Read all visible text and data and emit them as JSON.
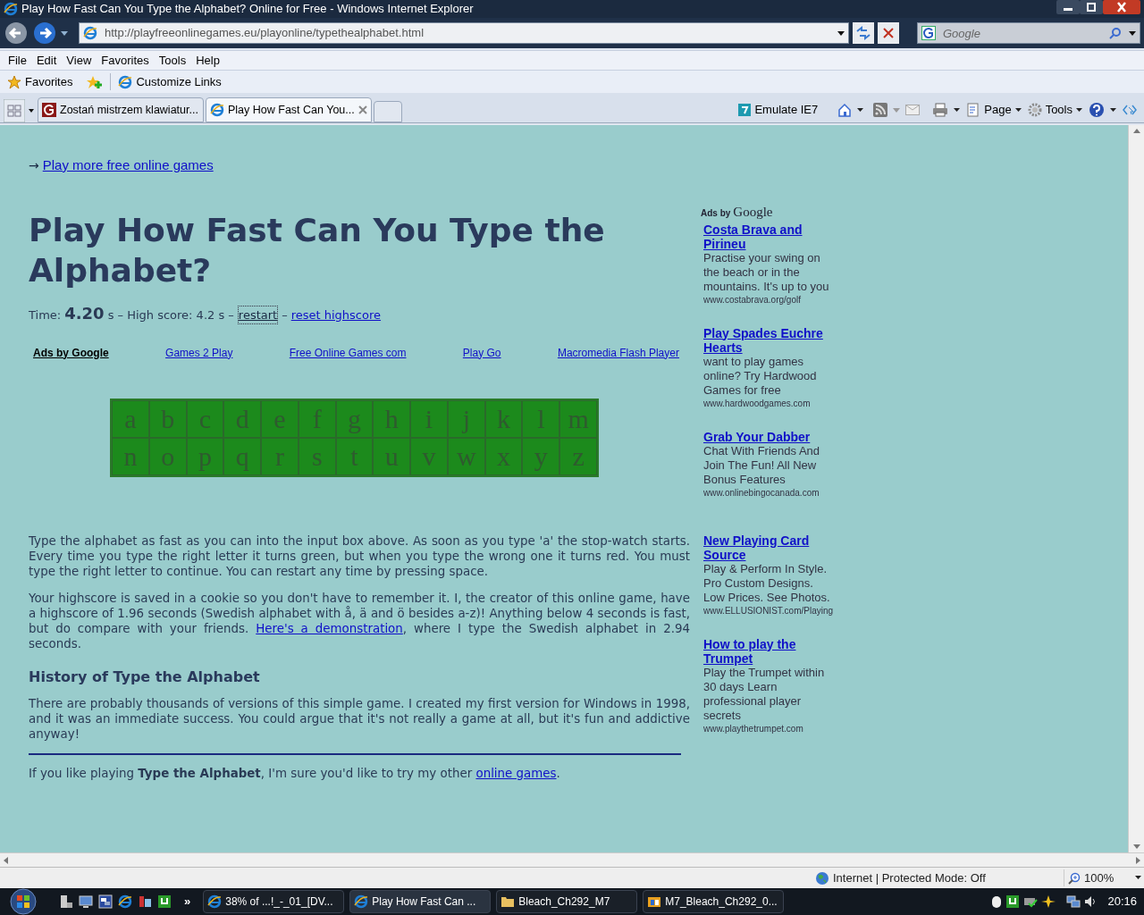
{
  "window": {
    "title": "Play How Fast Can You Type the Alphabet? Online for Free - Windows Internet Explorer"
  },
  "address": "http://playfreeonlinegames.eu/playonline/typethealphabet.html",
  "search": {
    "placeholder": "Google"
  },
  "menu": [
    "File",
    "Edit",
    "View",
    "Favorites",
    "Tools",
    "Help"
  ],
  "favorites_bar": {
    "favorites": "Favorites",
    "link": "Customize Links"
  },
  "tabs": [
    {
      "label": "Zostań mistrzem klawiatur...",
      "selected": false
    },
    {
      "label": "Play How Fast Can You...",
      "selected": true
    }
  ],
  "command_bar": {
    "emulate": "Emulate IE7",
    "page": "Page",
    "tools": "Tools"
  },
  "page": {
    "top_arrow": "→",
    "top_link": "Play more free online games",
    "heading": "Play How Fast Can You Type the Alphabet?",
    "timer": {
      "label": "Time:",
      "value": "4.20",
      "rest": "s – High score: 4.2 s –",
      "restart": "restart",
      "dash": "–",
      "reset": "reset highscore"
    },
    "ad_links": [
      "Ads by Google",
      "Games 2 Play",
      "Free Online Games com",
      "Play Go",
      "Macromedia Flash Player"
    ],
    "letters": [
      "a",
      "b",
      "c",
      "d",
      "e",
      "f",
      "g",
      "h",
      "i",
      "j",
      "k",
      "l",
      "m",
      "n",
      "o",
      "p",
      "q",
      "r",
      "s",
      "t",
      "u",
      "v",
      "w",
      "x",
      "y",
      "z"
    ],
    "intro": "Type the alphabet as fast as you can into the input box above. As soon as you type 'a' the stop-watch starts. Every time you type the right letter it turns green, but when you type the wrong one it turns red. You must type the right letter to continue. You can restart any time by pressing space.",
    "highscore": {
      "before": "Your highscore is saved in a cookie so you don't have to remember it. I, the creator of this online game, have a highscore of 1.96 seconds (Swedish alphabet with å, ä and ö besides a-z)! Anything below 4 seconds is fast, but do compare with your friends. ",
      "link": "Here's a demonstration",
      "after": ", where I type the Swedish alphabet in 2.94 seconds."
    },
    "history_heading": "History of Type the Alphabet",
    "history": "There are probably thousands of versions of this simple game. I created my first version for Windows in 1998, and it was an immediate success. You could argue that it's not really a game at all, but it's fun and addictive anyway!",
    "footer": {
      "before": "If you like playing **Type the Alphabet**, I'm sure you'd like to try my other ",
      "link": "online games",
      "after": "."
    }
  },
  "ads_sidebar": {
    "label": "Ads by",
    "brand": "Google",
    "ads": [
      {
        "title": "Costa Brava and Pirineu",
        "text": "Practise your swing on the beach or in the mountains. It's up to you",
        "url": "www.costabrava.org/golf"
      },
      {
        "title": "Play Spades Euchre Hearts",
        "text": "want to play games online? Try Hardwood Games for free",
        "url": "www.hardwoodgames.com"
      },
      {
        "title": "Grab Your Dabber",
        "text": "Chat With Friends And Join The Fun! All New Bonus Features",
        "url": "www.onlinebingocanada.com"
      },
      {
        "title": "New Playing Card Source",
        "text": "Play & Perform In Style. Pro Custom Designs. Low Prices. See Photos.",
        "url": "www.ELLUSIONIST.com/Playing"
      },
      {
        "title": "How to play the Trumpet",
        "text": "Play the Trumpet within 30 days Learn professional player secrets",
        "url": "www.playthetrumpet.com"
      }
    ]
  },
  "status_bar": {
    "zone": "Internet | Protected Mode: Off",
    "zoom": "100%"
  },
  "taskbar": {
    "quick_launch_more": "»",
    "items": [
      {
        "label": "38% of ...!_-_01_[DV...",
        "kind": "browser",
        "selected": false
      },
      {
        "label": "Play How Fast Can ...",
        "kind": "browser",
        "selected": true
      },
      {
        "label": "Bleach_Ch292_M7",
        "kind": "folder",
        "selected": false
      },
      {
        "label": "M7_Bleach_Ch292_0...",
        "kind": "viewer",
        "selected": false
      }
    ],
    "clock": "20:16"
  }
}
